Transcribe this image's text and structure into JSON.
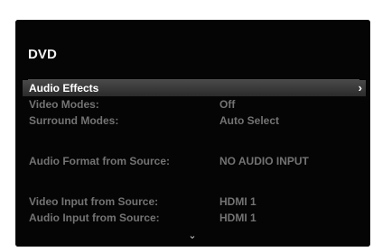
{
  "screen": {
    "title": "DVD"
  },
  "menu": {
    "items": [
      {
        "label": "Audio Effects",
        "value": "",
        "selected": true,
        "arrow": "›"
      },
      {
        "label": "Video Modes:",
        "value": "Off",
        "selected": false
      },
      {
        "label": "Surround Modes:",
        "value": "Auto Select",
        "selected": false
      },
      {
        "label": "Audio Format from Source:",
        "value": "NO AUDIO INPUT",
        "selected": false
      },
      {
        "label": "Video Input from Source:",
        "value": "HDMI 1",
        "selected": false
      },
      {
        "label": "Audio Input from Source:",
        "value": "HDMI 1",
        "selected": false
      }
    ]
  },
  "navigation": {
    "scroll_down_icon": "chevron-down-icon",
    "scroll_down_glyph": "⌄"
  },
  "colors": {
    "panel_background": "#050505",
    "selected_row_top": "#494949",
    "selected_row_bottom": "#2b2b2b",
    "dim_text": "#737373",
    "bright_text": "#ffffff"
  }
}
